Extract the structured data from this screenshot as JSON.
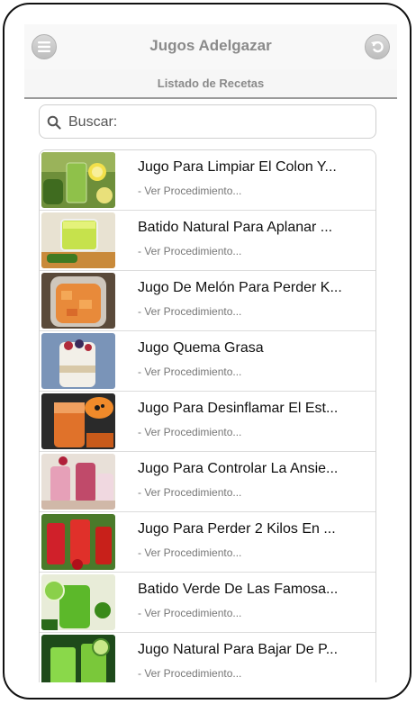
{
  "header": {
    "title": "Jugos Adelgazar",
    "menu_icon": "menu-icon",
    "back_icon": "back-icon"
  },
  "subheader": {
    "label": "Listado de Recetas"
  },
  "search": {
    "placeholder": "Buscar:"
  },
  "colors": {
    "header_text": "#8a8a8a",
    "item_title": "#111111",
    "item_sub": "#777777"
  },
  "recipes": [
    {
      "title": "Jugo Para Limpiar El Colon Y...",
      "subtitle": "- Ver Procedimiento...",
      "thumb": "green-lemon-juice"
    },
    {
      "title": "Batido Natural Para Aplanar ...",
      "subtitle": "- Ver Procedimiento...",
      "thumb": "green-cup-drink"
    },
    {
      "title": "Jugo De Melón Para Perder K...",
      "subtitle": "- Ver Procedimiento...",
      "thumb": "melon-blender"
    },
    {
      "title": "Jugo Quema Grasa",
      "subtitle": "- Ver Procedimiento...",
      "thumb": "yogurt-berries"
    },
    {
      "title": "Jugo Para Desinflamar El Est...",
      "subtitle": "- Ver Procedimiento...",
      "thumb": "papaya-smoothie"
    },
    {
      "title": "Jugo Para Controlar La Ansie...",
      "subtitle": "- Ver Procedimiento...",
      "thumb": "berry-smoothies"
    },
    {
      "title": "Jugo Para Perder 2 Kilos En ...",
      "subtitle": "- Ver Procedimiento...",
      "thumb": "red-juices"
    },
    {
      "title": "Batido Verde De Las Famosa...",
      "subtitle": "- Ver Procedimiento...",
      "thumb": "green-smoothie"
    },
    {
      "title": "Jugo Natural Para Bajar De P...",
      "subtitle": "- Ver Procedimiento...",
      "thumb": "cucumber-juice"
    }
  ]
}
